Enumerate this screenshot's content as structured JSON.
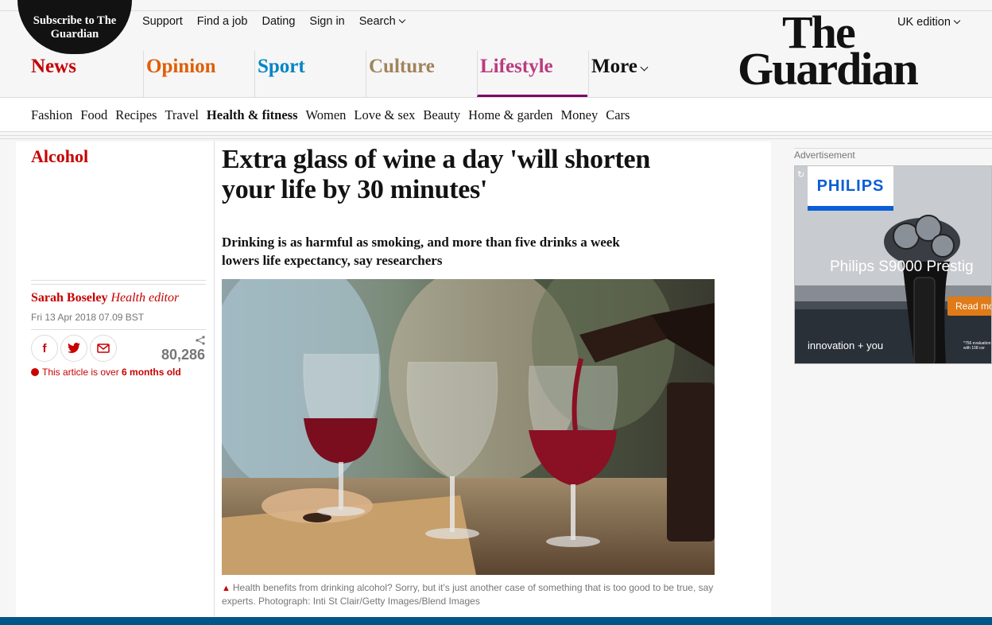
{
  "header": {
    "subscribe_line1": "Subscribe to The",
    "subscribe_line2": "Guardian",
    "links": [
      "Support",
      "Find a job",
      "Dating",
      "Sign in",
      "Search"
    ],
    "edition": "UK edition",
    "logo_line1": "The",
    "logo_line2": "Guardian"
  },
  "pillars": [
    {
      "label": "News",
      "color": "#c70000"
    },
    {
      "label": "Opinion",
      "color": "#e05e00"
    },
    {
      "label": "Sport",
      "color": "#0084c6"
    },
    {
      "label": "Culture",
      "color": "#a1845c"
    },
    {
      "label": "Lifestyle",
      "color": "#bb3b80"
    },
    {
      "label": "More",
      "color": "#121212"
    }
  ],
  "subnav": [
    "Fashion",
    "Food",
    "Recipes",
    "Travel",
    "Health & fitness",
    "Women",
    "Love & sex",
    "Beauty",
    "Home & garden",
    "Money",
    "Cars"
  ],
  "article": {
    "section": "Alcohol",
    "headline": "Extra glass of wine a day 'will shorten your life by 30 minutes'",
    "standfirst": "Drinking is as harmful as smoking, and more than five drinks a week lowers life expectancy, say researchers",
    "author": "Sarah Boseley",
    "author_role": "Health editor",
    "date": "Fri 13 Apr 2018 07.09 BST",
    "share_count": "80,286",
    "age_prefix": "This article is over",
    "age_value": "6 months old",
    "caption": "Health benefits from drinking alcohol? Sorry, but it's just another case of something that is too good to be true, say experts. Photograph: Inti St Clair/Getty Images/Blend Images"
  },
  "share": {
    "facebook": "f",
    "twitter": "t",
    "email": "@"
  },
  "ad": {
    "label": "Advertisement",
    "brand": "PHILIPS",
    "title": "Philips S9000 Prestig",
    "button": "Read mo",
    "tagline": "innovation + you",
    "fine_line1": "*756 evaluation",
    "fine_line2": "with 108 cor"
  },
  "colors": {
    "accent": "#c70000",
    "lifestyle_underline": "#7d0068",
    "footer": "#005689"
  }
}
